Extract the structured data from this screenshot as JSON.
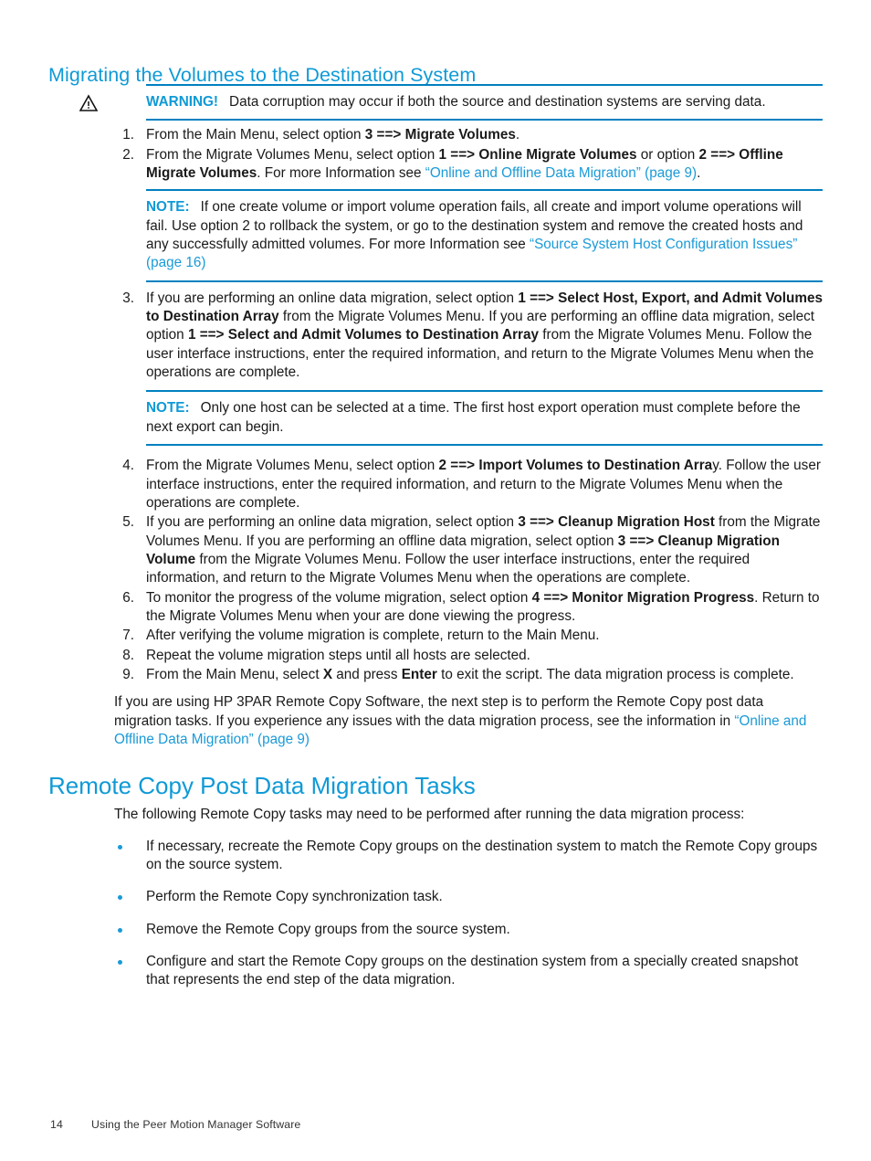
{
  "headings": {
    "section_title": "Migrating the Volumes to the Destination System",
    "remote_copy_title": "Remote Copy Post Data Migration Tasks"
  },
  "colors": {
    "heading_blue": "#0f9ad6",
    "link_blue": "#1a9ad7",
    "rule_blue": "#0080c0",
    "body_black": "#1a1a1a"
  },
  "warning": {
    "icon": "warning-triangle-icon",
    "label": "WARNING!",
    "text": "Data corruption may occur if both the source and destination systems are serving data."
  },
  "steps": [
    {
      "num": "1.",
      "parts": [
        {
          "t": "From the Main Menu, select option ",
          "s": "normal"
        },
        {
          "t": "3 ==> Migrate Volumes",
          "s": "bold"
        },
        {
          "t": ".",
          "s": "normal"
        }
      ]
    },
    {
      "num": "2.",
      "parts": [
        {
          "t": "From the Migrate Volumes Menu, select option ",
          "s": "normal"
        },
        {
          "t": "1 ==> Online Migrate Volumes",
          "s": "bold"
        },
        {
          "t": " or option ",
          "s": "normal"
        },
        {
          "t": "2 ==> Offline Migrate Volumes",
          "s": "bold"
        },
        {
          "t": ". For more Information see ",
          "s": "normal"
        },
        {
          "t": "“Online and Offline Data Migration” (page 9)",
          "s": "link"
        },
        {
          "t": ".",
          "s": "normal"
        }
      ]
    },
    {
      "num": "3.",
      "parts": [
        {
          "t": "If you are performing an online data migration, select option ",
          "s": "normal"
        },
        {
          "t": "1 ==> Select Host, Export, and Admit Volumes to Destination Array",
          "s": "bold"
        },
        {
          "t": " from the Migrate Volumes Menu. If you are performing an offline data migration, select option ",
          "s": "normal"
        },
        {
          "t": "1 ==> Select and Admit Volumes to Destination Array",
          "s": "bold"
        },
        {
          "t": " from the Migrate Volumes Menu. Follow the user interface instructions, enter the required information, and return to the Migrate Volumes Menu when the operations are complete.",
          "s": "normal"
        }
      ]
    },
    {
      "num": "4.",
      "parts": [
        {
          "t": "From the Migrate Volumes Menu, select option ",
          "s": "normal"
        },
        {
          "t": "2 ==> Import Volumes to Destination Arra",
          "s": "bold"
        },
        {
          "t": "y. Follow the user interface instructions, enter the required information, and return to the Migrate Volumes Menu when the operations are complete.",
          "s": "normal"
        }
      ]
    },
    {
      "num": "5.",
      "parts": [
        {
          "t": "If you are performing an online data migration, select option ",
          "s": "normal"
        },
        {
          "t": "3 ==> Cleanup Migration Host",
          "s": "bold"
        },
        {
          "t": " from the Migrate Volumes Menu. If you are performing an offline data migration, select option ",
          "s": "normal"
        },
        {
          "t": "3 ==> Cleanup Migration Volume",
          "s": "bold"
        },
        {
          "t": " from the Migrate Volumes Menu. Follow the user interface instructions, enter the required information, and return to the Migrate Volumes Menu when the operations are complete.",
          "s": "normal"
        }
      ]
    },
    {
      "num": "6.",
      "parts": [
        {
          "t": "To monitor the progress of the volume migration, select option ",
          "s": "normal"
        },
        {
          "t": "4 ==> Monitor Migration Progress",
          "s": "bold"
        },
        {
          "t": ". Return to the Migrate Volumes Menu when your are done viewing the progress.",
          "s": "normal"
        }
      ]
    },
    {
      "num": "7.",
      "parts": [
        {
          "t": "After verifying the volume migration is complete, return to the Main Menu.",
          "s": "normal"
        }
      ]
    },
    {
      "num": "8.",
      "parts": [
        {
          "t": "Repeat the volume migration steps until all hosts are selected.",
          "s": "normal"
        }
      ]
    },
    {
      "num": "9.",
      "parts": [
        {
          "t": "From the Main Menu, select ",
          "s": "normal"
        },
        {
          "t": "X",
          "s": "bold"
        },
        {
          "t": " and press ",
          "s": "normal"
        },
        {
          "t": "Enter",
          "s": "bold"
        },
        {
          "t": " to exit the script. The data migration process is complete.",
          "s": "normal"
        }
      ]
    }
  ],
  "note1": {
    "label": "NOTE:",
    "parts": [
      {
        "t": "If one create volume or import volume operation fails, all create and import volume operations will fail. Use option 2 to rollback the system, or go to the destination system and remove the created hosts and any successfully admitted volumes. For more Information see ",
        "s": "normal"
      },
      {
        "t": "“Source System Host Configuration Issues” (page 16)",
        "s": "link"
      }
    ]
  },
  "note2": {
    "label": "NOTE:",
    "parts": [
      {
        "t": "Only one host can be selected at a time. The first host export operation must complete before the next export can begin.",
        "s": "normal"
      }
    ]
  },
  "closing_paragraph": {
    "parts": [
      {
        "t": "If you are using HP 3PAR Remote Copy Software, the next step is to perform the Remote Copy post data migration tasks. If you experience any issues with the data migration process, see the information in ",
        "s": "normal"
      },
      {
        "t": "“Online and Offline Data Migration” (page 9)",
        "s": "link"
      }
    ]
  },
  "remote_copy_intro": "The following Remote Copy tasks may need to be performed after running the data migration process:",
  "bullets": [
    "If necessary, recreate the Remote Copy groups on the destination system to match the Remote Copy groups on the source system.",
    "Perform the Remote Copy synchronization task.",
    "Remove the Remote Copy groups from the source system.",
    "Configure and start the Remote Copy groups on the destination system from a specially created snapshot that represents the end step of the data migration."
  ],
  "footer": {
    "page_number": "14",
    "chapter_title": "Using the Peer Motion Manager Software"
  }
}
